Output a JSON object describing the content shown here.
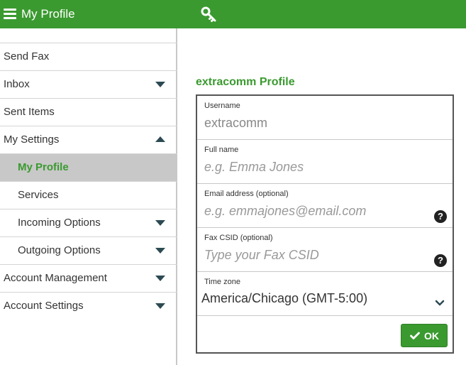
{
  "topbar": {
    "title": "My Profile",
    "menu_icon": "hamburger-menu-icon",
    "key_icon": "key-icon",
    "bg_color": "#3a9a2f"
  },
  "sidebar": {
    "items": [
      {
        "label": "Send Fax",
        "level": "top",
        "caret": "none"
      },
      {
        "label": "Inbox",
        "level": "top",
        "caret": "down"
      },
      {
        "label": "Sent Items",
        "level": "top",
        "caret": "none"
      },
      {
        "label": "My Settings",
        "level": "top",
        "caret": "up"
      },
      {
        "label": "My Profile",
        "level": "sub",
        "caret": "none",
        "active": true
      },
      {
        "label": "Services",
        "level": "sub",
        "caret": "none"
      },
      {
        "label": "Incoming Options",
        "level": "sub",
        "caret": "down"
      },
      {
        "label": "Outgoing Options",
        "level": "sub",
        "caret": "down"
      },
      {
        "label": "Account Management",
        "level": "top",
        "caret": "down"
      },
      {
        "label": "Account Settings",
        "level": "top",
        "caret": "down"
      }
    ]
  },
  "profile": {
    "title": "extracomm Profile",
    "username": {
      "label": "Username",
      "value": "extracomm"
    },
    "fullname": {
      "label": "Full name",
      "placeholder": "e.g. Emma Jones"
    },
    "email": {
      "label": "Email address (optional)",
      "placeholder": "e.g. emmajones@email.com",
      "help_icon": "question-circle-icon"
    },
    "fax_csid": {
      "label": "Fax CSID (optional)",
      "placeholder": "Type your Fax CSID",
      "help_icon": "question-circle-icon"
    },
    "timezone": {
      "label": "Time zone",
      "value": "America/Chicago (GMT-5:00)",
      "icon": "chevron-down-icon"
    },
    "ok_button": {
      "label": "OK",
      "icon": "check-icon"
    }
  }
}
